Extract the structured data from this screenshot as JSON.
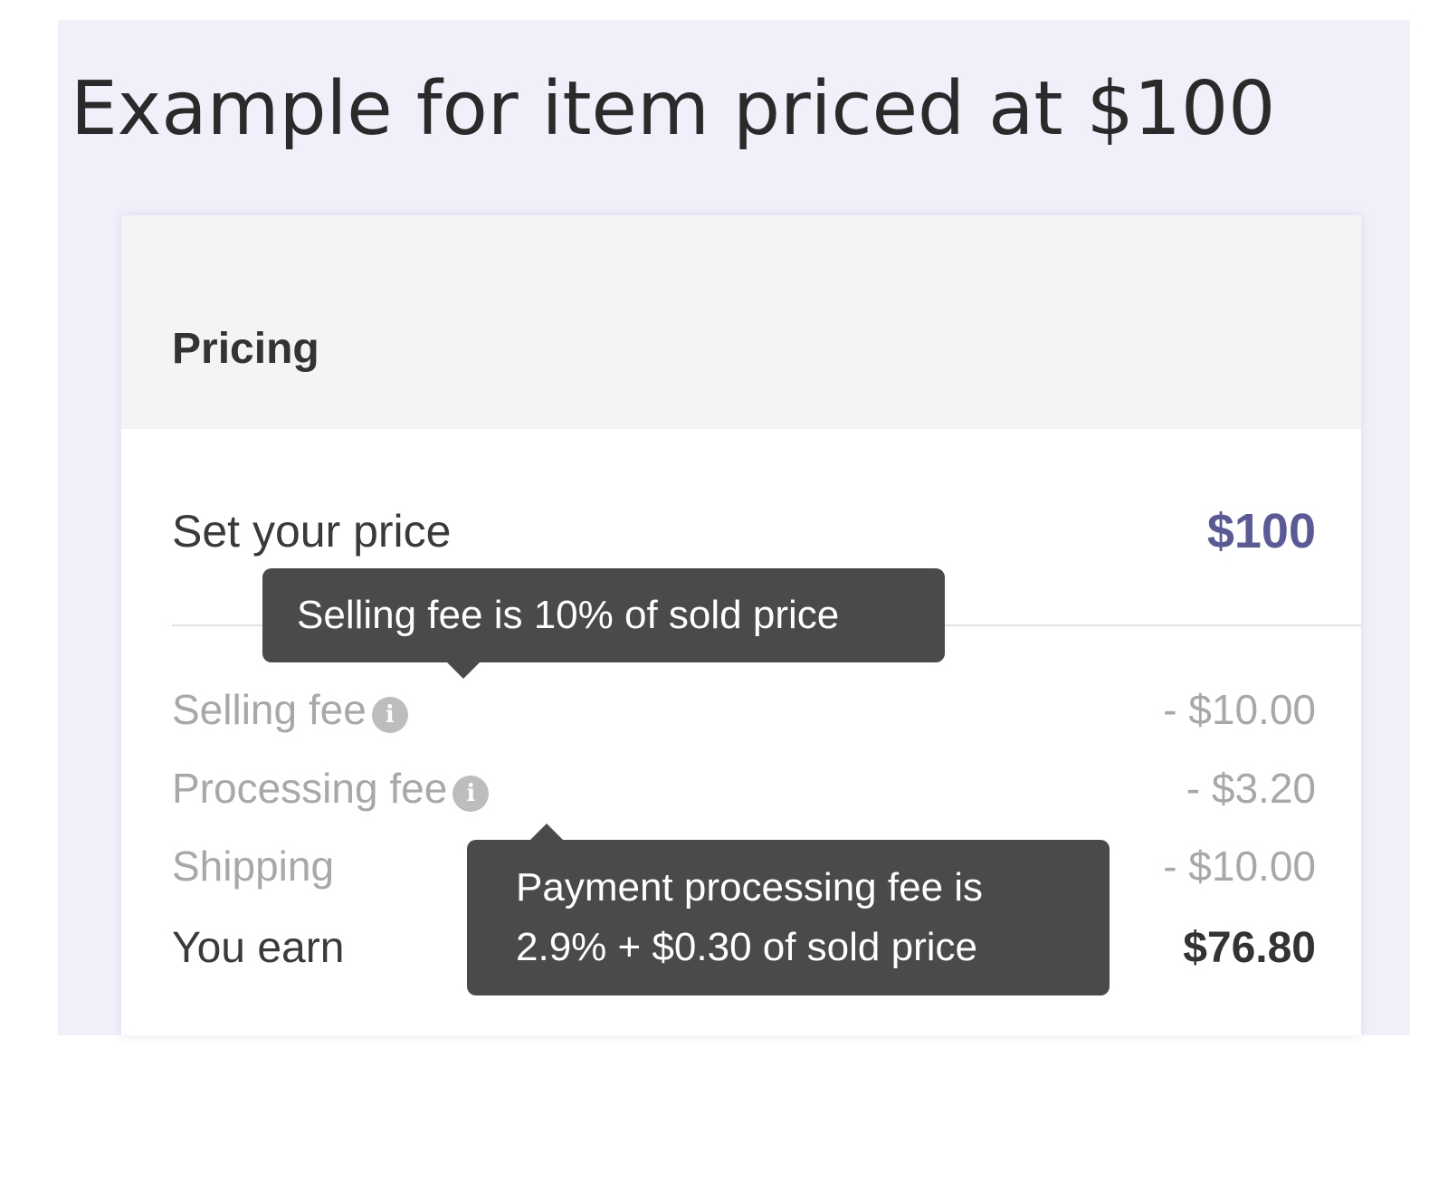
{
  "heading": "Example for item priced at $100",
  "card": {
    "title": "Pricing",
    "set_price": {
      "label": "Set your price",
      "value": "$100"
    },
    "selling_fee": {
      "label": "Selling fee",
      "value": "- $10.00",
      "info_icon": "info-icon"
    },
    "processing_fee": {
      "label": "Processing fee",
      "value": "- $3.20",
      "info_icon": "info-icon"
    },
    "shipping": {
      "label": "Shipping",
      "value": "- $10.00"
    },
    "you_earn": {
      "label": "You earn",
      "value": "$76.80"
    }
  },
  "tooltips": {
    "selling_fee": "Selling fee is 10% of sold price",
    "processing_fee": [
      "Payment processing fee is",
      "2.9% + $0.30 of sold price"
    ]
  },
  "colors": {
    "page_background": "#f0f0fb",
    "card_header_background": "#f4f4f4",
    "price_accent": "#5a5a98",
    "tooltip_background": "#4a4a4a",
    "muted_text": "#a8a8a8"
  }
}
